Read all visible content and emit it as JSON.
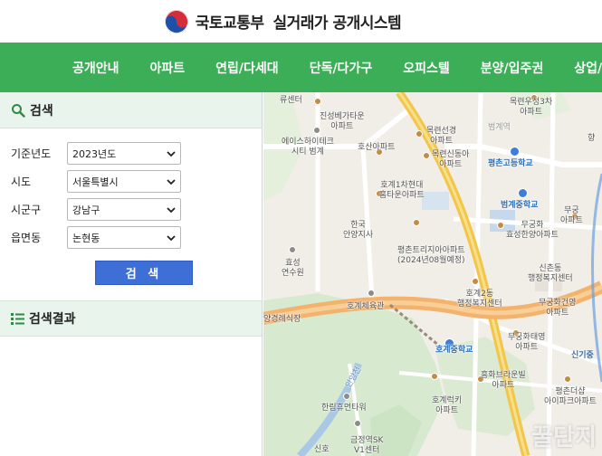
{
  "header": {
    "ministry": "국토교통부",
    "system": "실거래가 공개시스템"
  },
  "nav": [
    "공개안내",
    "아파트",
    "연립/다세대",
    "단독/다가구",
    "오피스텔",
    "분양/입주권",
    "상업/업"
  ],
  "search_panel": {
    "title": "검색",
    "fields": [
      {
        "label": "기준년도",
        "value": "2023년도"
      },
      {
        "label": "시도",
        "value": "서울특별시"
      },
      {
        "label": "시군구",
        "value": "강남구"
      },
      {
        "label": "읍면동",
        "value": "논현동"
      }
    ],
    "button": "검 색"
  },
  "results_panel": {
    "title": "검색결과"
  },
  "map_labels": [
    {
      "text": "류센터"
    },
    {
      "text": "목련우성3차\n아파트"
    },
    {
      "text": "범계역"
    },
    {
      "text": "진성베가타운\n아파트"
    },
    {
      "text": "목련선경\n아파트"
    },
    {
      "text": "에이스하이테크\n시티 범계"
    },
    {
      "text": "호산아파트"
    },
    {
      "text": "목련신동아\n아파트"
    },
    {
      "text": "평촌고등학교"
    },
    {
      "text": "호계1차현대\n홈타운아파트"
    },
    {
      "text": "범계중학교"
    },
    {
      "text": "한국\n안양지사"
    },
    {
      "text": "무궁화\n효성한양아파트"
    },
    {
      "text": "무궁\n아파트"
    },
    {
      "text": "평촌트리지아아파트\n(2024년08월예정)"
    },
    {
      "text": "효성\n연수원"
    },
    {
      "text": "신촌동\n행정복지센터"
    },
    {
      "text": "호계2동\n행정복지센터"
    },
    {
      "text": "무궁화건영\n아파트"
    },
    {
      "text": "호계체육관"
    },
    {
      "text": "양경례식장"
    },
    {
      "text": "무궁화태영\n아파트"
    },
    {
      "text": "호계중학교"
    },
    {
      "text": "신기중"
    },
    {
      "text": "흥화브라운빌\n아파트"
    },
    {
      "text": "호계럭키\n아파트"
    },
    {
      "text": "평촌더샵\n아이파크아파트"
    },
    {
      "text": "한림휴먼타워"
    },
    {
      "text": "금정역SK\nV1센터"
    },
    {
      "text": "향"
    },
    {
      "text": "안양천"
    },
    {
      "text": "신호"
    }
  ],
  "watermark": "꿀단지",
  "colors": {
    "nav_bg": "#3cae57",
    "panel_head_bg": "#e9f5ec",
    "button_bg": "#3d6fd6"
  }
}
